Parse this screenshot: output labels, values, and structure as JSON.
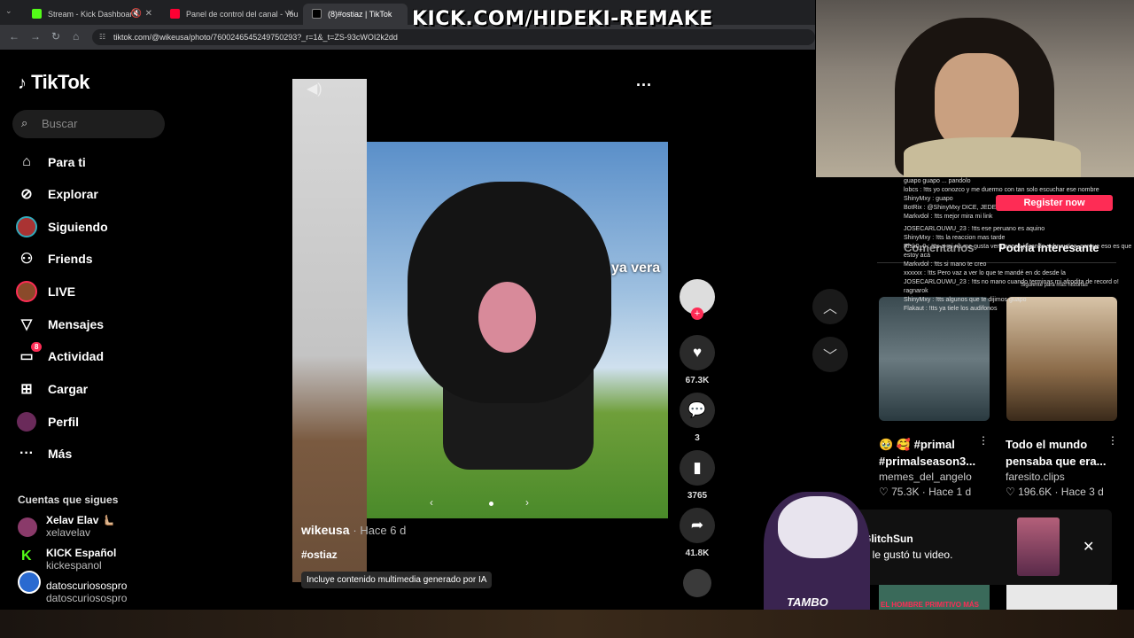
{
  "browser": {
    "tabs": [
      {
        "title": "Stream - Kick Dashboard"
      },
      {
        "title": "Panel de control del canal - You"
      },
      {
        "title": "(8)#ostiaz | TikTok"
      }
    ],
    "url": "tiktok.com/@wikeusa/photo/7600246545249750293?_r=1&_t=ZS-93cWOI2k2dd"
  },
  "overlay": {
    "banner": "KICK.COM/HIDEKI-REMAKE",
    "register": "Register now",
    "mascot_label": "TAMBO"
  },
  "sidebar": {
    "logo": "TikTok",
    "search_placeholder": "Buscar",
    "nav": [
      {
        "label": "Para ti",
        "icon": "home-icon"
      },
      {
        "label": "Explorar",
        "icon": "compass-icon"
      },
      {
        "label": "Siguiendo",
        "icon": "following-icon"
      },
      {
        "label": "Friends",
        "icon": "friends-icon"
      },
      {
        "label": "LIVE",
        "icon": "live-icon"
      },
      {
        "label": "Mensajes",
        "icon": "send-icon"
      },
      {
        "label": "Actividad",
        "icon": "inbox-icon",
        "badge": "8"
      },
      {
        "label": "Cargar",
        "icon": "plus-square-icon"
      },
      {
        "label": "Perfil",
        "icon": "avatar"
      },
      {
        "label": "Más",
        "icon": "more-icon"
      }
    ],
    "following_header": "Cuentas que sigues",
    "accounts": [
      {
        "name": "Xelav Elav 🫷🏼",
        "user": "xelavelav"
      },
      {
        "name": "KICK Español",
        "user": "kickespanol"
      },
      {
        "name": "datoscuriosospro",
        "user": "datoscuriosospro"
      }
    ]
  },
  "post": {
    "overlay_caption": "ya vera",
    "author": "wikeusa",
    "time": "· Hace 6 d",
    "hashtag": "#ostiaz",
    "ai_label": "Incluye contenido multimedia generado por IA",
    "actions": {
      "likes": "67.3K",
      "comments": "3",
      "saves": "3765",
      "shares": "41.8K"
    }
  },
  "right_panel": {
    "tab_comments": "Comentarios",
    "tab_interesting": "Podría interesante",
    "hint": "Siguiente para más historias",
    "cards": [
      {
        "title": "🥹 🥰 #primal #primalseason3...",
        "user": "memes_del_angelo",
        "likes": "♡ 75.3K",
        "time": "· Hace 1 d"
      },
      {
        "title": "Todo el mundo pensaba que era...",
        "user": "faresito.clips",
        "likes": "♡ 196.6K",
        "time": "· Hace 3 d"
      }
    ],
    "bottom_card_text": "EL HOMBRE PRIMITIVO MÁS"
  },
  "chat": [
    "guapo guapo ... pandolo",
    "lobcs : !tts yo conozco y me duermo con tan solo escuchar ese nombre",
    "ShinyMxy : guapo",
    "BotRix : @ShinyMxy DICE, JEDE ESTAS MAS GUAPO O ME PARECE?",
    "Markvdol : !tts mejor mira mi link",
    "JOSECARLOUWU_23 : !tts ese peruano es aquino",
    "ShinyMxy : !tts la reaccion mas tarde",
    "Risk0_0 : !tts a mi no me gusta ver guapos jugando subnautica, porque eso es que estoy acá",
    "Markvdol : !tts si mano te creo",
    "xxxxxx : !tts Pero vaz a ver lo que te mandé en dc desde la",
    "JOSECARLOUWU_23 : !tts no mano cuando terminas mi afrodita de record o!",
    "ragnarok",
    "ShinyMxy : !tts algunos que te dijimos guapo",
    "Flakaut : !tts ya tiele los audifonos"
  ],
  "notification": {
    "name": "GlitchSun",
    "text": "A le gustó tu video."
  }
}
